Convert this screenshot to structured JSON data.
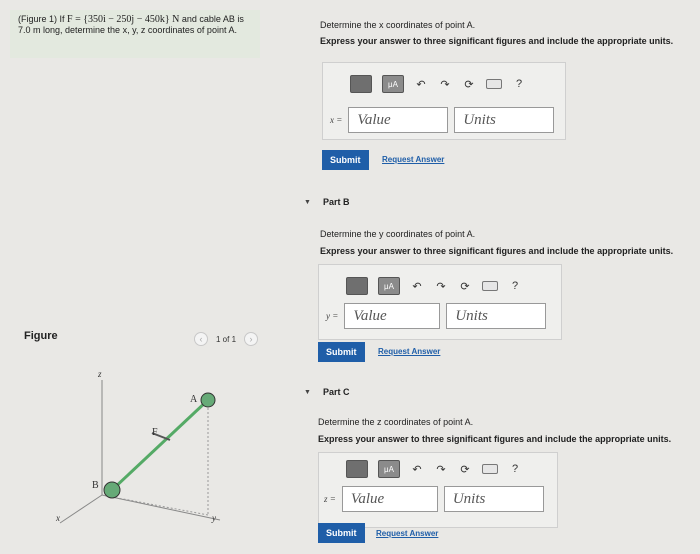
{
  "problem": {
    "prefix": "(Figure 1) If ",
    "vector": "F = {350i − 250j − 450k} N",
    "mid": " and cable AB is ",
    "length": "7.0 m",
    "suffix": " long, determine the x, y, z coordinates of point A."
  },
  "figure": {
    "label": "Figure",
    "pager": "1 of 1",
    "prev_icon": "chevron-left-icon",
    "next_icon": "chevron-right-icon",
    "labels": {
      "z": "z",
      "A": "A",
      "F": "F",
      "B": "B",
      "x": "x",
      "y": "y"
    }
  },
  "parts": [
    {
      "head": "",
      "prompt": "Determine the x coordinates of point A.",
      "instruction": "Express your answer to three significant figures and include the appropriate units.",
      "var": "x =",
      "value_placeholder": "Value",
      "units_placeholder": "Units",
      "submit": "Submit",
      "request": "Request Answer"
    },
    {
      "head": "Part B",
      "prompt": "Determine the y coordinates of point A.",
      "instruction": "Express your answer to three significant figures and include the appropriate units.",
      "var": "y =",
      "value_placeholder": "Value",
      "units_placeholder": "Units",
      "submit": "Submit",
      "request": "Request Answer"
    },
    {
      "head": "Part C",
      "prompt": "Determine the z coordinates of point A.",
      "instruction": "Express your answer to three significant figures and include the appropriate units.",
      "var": "z =",
      "value_placeholder": "Value",
      "units_placeholder": "Units",
      "submit": "Submit",
      "request": "Request Answer"
    }
  ],
  "toolbar": {
    "mu_label": "μA",
    "help": "?"
  }
}
